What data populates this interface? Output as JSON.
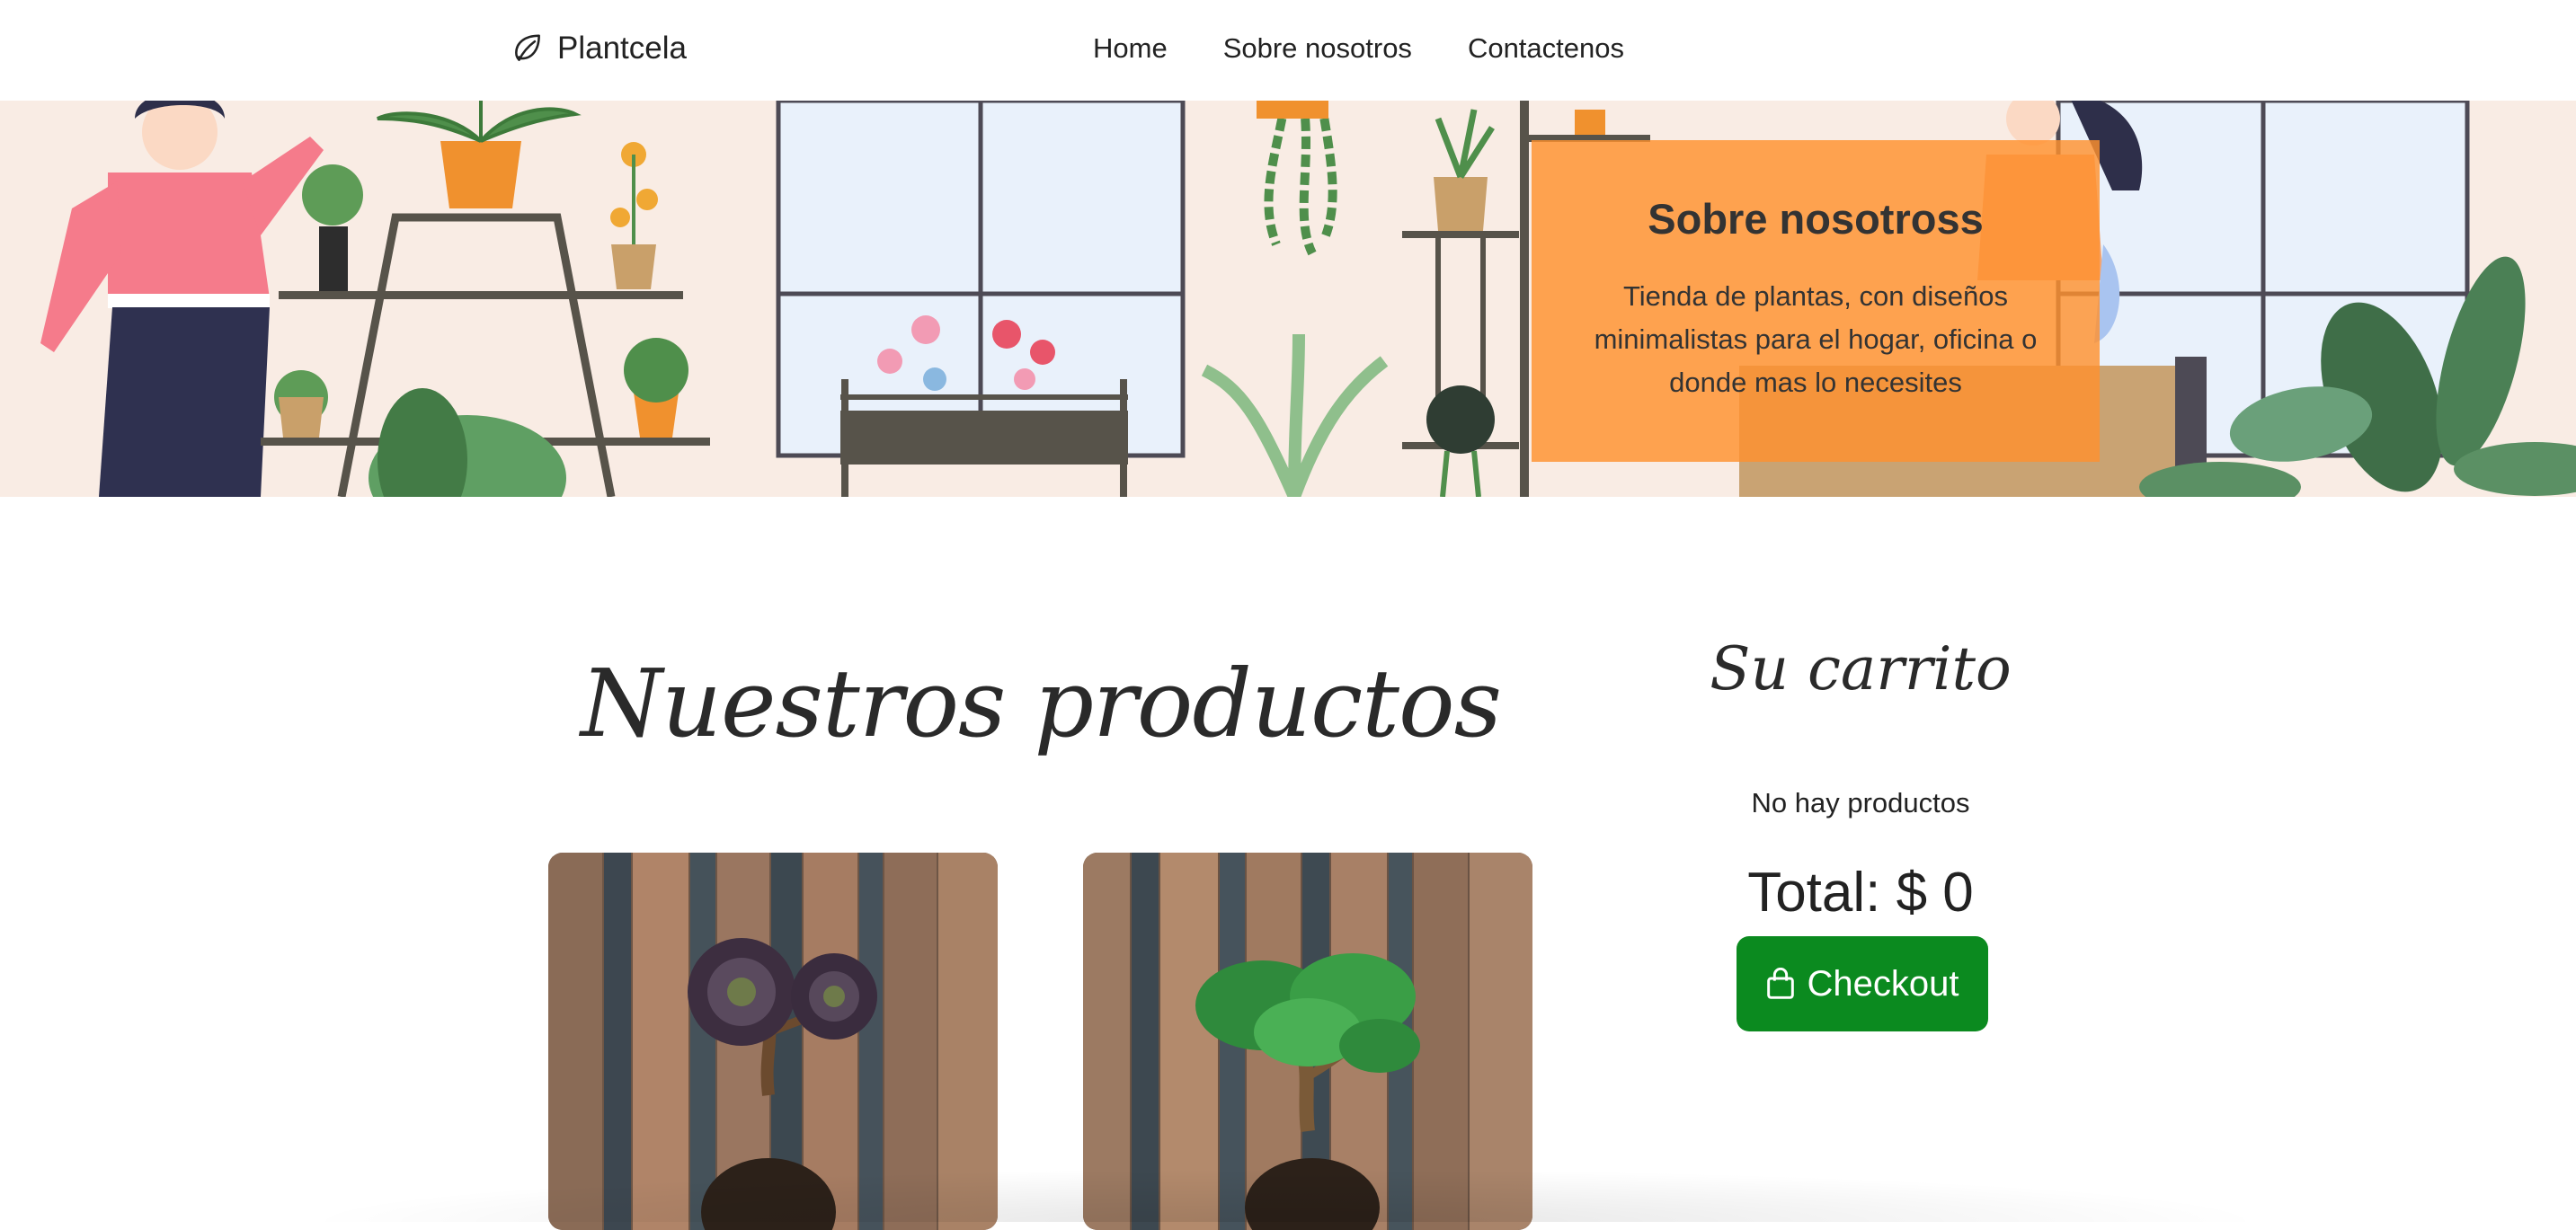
{
  "navbar": {
    "brand": "Plantcela",
    "brand_icon": "leaf-icon",
    "links": [
      "Home",
      "Sobre nosotros",
      "Contactenos"
    ]
  },
  "hero": {
    "title": "Sobre nosotross",
    "description": "Tienda de plantas, con diseños minimalistas para el hogar, oficina o donde mas lo necesites",
    "box_color": "#ff9a3e"
  },
  "products": {
    "title": "Nuestros productos",
    "items": [
      {
        "image": "dark-succulent-bonsai-photo"
      },
      {
        "image": "green-succulent-bonsai-photo"
      }
    ]
  },
  "cart": {
    "title": "Su carrito",
    "empty_text": "No hay productos",
    "total_text": "Total: $ 0",
    "checkout_label": "Checkout",
    "checkout_icon": "shopping-bag-icon",
    "checkout_color": "#0b8a1f"
  }
}
